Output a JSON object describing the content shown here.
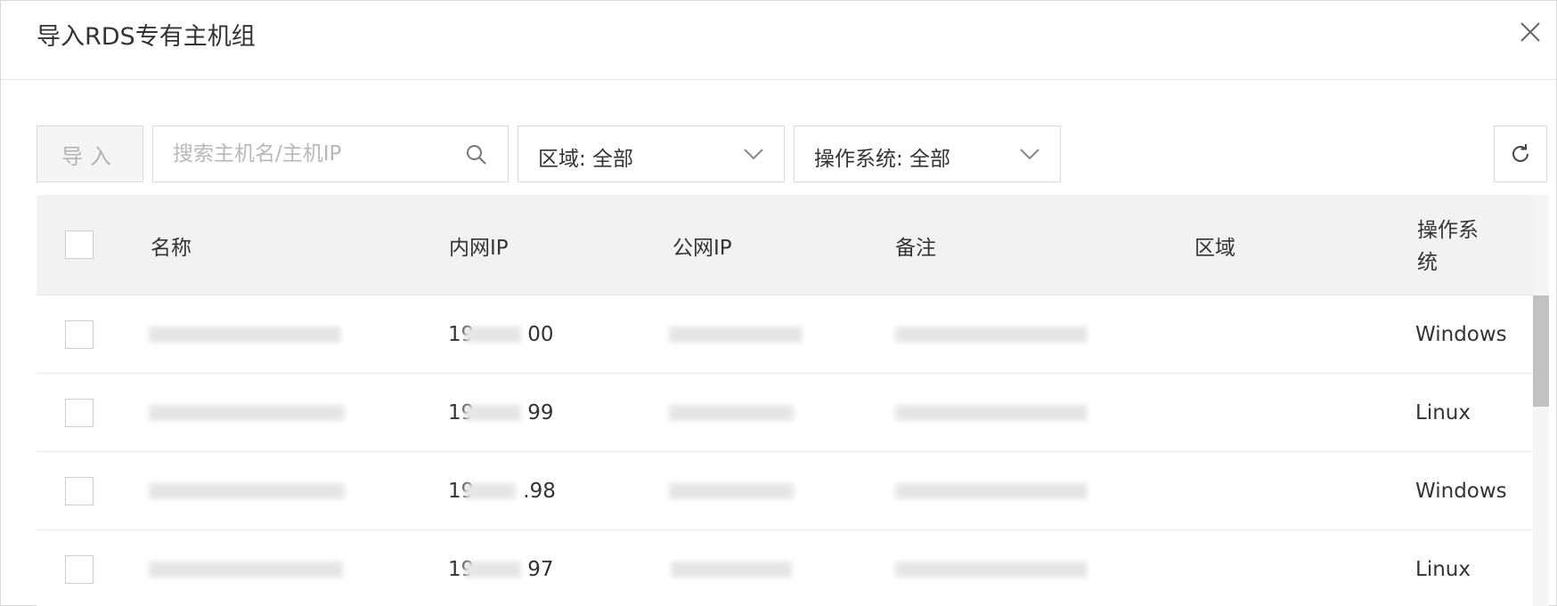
{
  "dialog": {
    "title": "导入RDS专有主机组"
  },
  "toolbar": {
    "import_label": "导入",
    "search_placeholder": "搜索主机名/主机IP",
    "region_select": "区域: 全部",
    "os_select": "操作系统: 全部"
  },
  "table": {
    "columns": {
      "name": "名称",
      "private_ip": "内网IP",
      "public_ip": "公网IP",
      "remark": "备注",
      "region": "区域",
      "os": "操作系统"
    },
    "rows": [
      {
        "ip_prefix": "19",
        "ip_suffix": "00",
        "os": "Windows"
      },
      {
        "ip_prefix": "19",
        "ip_suffix": "99",
        "os": "Linux"
      },
      {
        "ip_prefix": "19",
        "ip_suffix": ".98",
        "os": "Windows"
      },
      {
        "ip_prefix": "19",
        "ip_suffix": "97",
        "os": "Linux"
      }
    ]
  },
  "icons": {
    "close": "close-icon",
    "search": "search-icon",
    "chevron": "chevron-down-icon",
    "refresh": "refresh-icon"
  },
  "colors": {
    "header_bg": "#f2f2f2",
    "border": "#d9d9d9",
    "disabled_text": "#b3b3b3"
  }
}
